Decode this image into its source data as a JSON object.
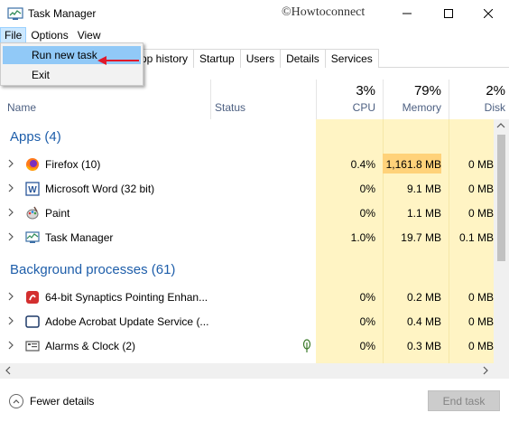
{
  "window": {
    "title": "Task Manager",
    "watermark": "©Howtoconnect",
    "minimize_glyph": "—",
    "maximize_glyph": "☐",
    "close_glyph": "✕"
  },
  "menu": {
    "file": "File",
    "options": "Options",
    "view": "View"
  },
  "file_menu": {
    "run_new_task": "Run new task",
    "exit": "Exit"
  },
  "tabs": [
    "pp history",
    "Startup",
    "Users",
    "Details",
    "Services"
  ],
  "columns": {
    "name": "Name",
    "status": "Status",
    "cpu_pct": "3%",
    "cpu": "CPU",
    "memory_pct": "79%",
    "memory": "Memory",
    "disk_pct": "2%",
    "disk": "Disk"
  },
  "groups": {
    "apps": "Apps (4)",
    "background": "Background processes (61)"
  },
  "apps": [
    {
      "name": "Firefox (10)",
      "icon": "firefox-icon",
      "cpu": "0.4%",
      "memory": "1,161.8 MB",
      "disk": "0 MB"
    },
    {
      "name": "Microsoft Word (32 bit)",
      "icon": "word-icon",
      "cpu": "0%",
      "memory": "9.1 MB",
      "disk": "0 MB"
    },
    {
      "name": "Paint",
      "icon": "paint-icon",
      "cpu": "0%",
      "memory": "1.1 MB",
      "disk": "0 MB"
    },
    {
      "name": "Task Manager",
      "icon": "task-manager-icon",
      "cpu": "1.0%",
      "memory": "19.7 MB",
      "disk": "0.1 MB"
    }
  ],
  "background": [
    {
      "name": "64-bit Synaptics Pointing Enhan...",
      "icon": "synaptics-icon",
      "cpu": "0%",
      "memory": "0.2 MB",
      "disk": "0 MB"
    },
    {
      "name": "Adobe Acrobat Update Service (...",
      "icon": "service-icon",
      "cpu": "0%",
      "memory": "0.4 MB",
      "disk": "0 MB"
    },
    {
      "name": "Alarms & Clock (2)",
      "icon": "alarms-icon",
      "cpu": "0%",
      "memory": "0.3 MB",
      "disk": "0 MB",
      "status_icon": "leaf-icon"
    }
  ],
  "footer": {
    "fewer_details": "Fewer details",
    "end_task": "End task"
  },
  "colors": {
    "accent": "#1e5eaa",
    "highlight": "#91c9f7",
    "heat_light": "#fff4c4",
    "heat_strong": "#ffd27a",
    "arrow": "#e0192b"
  }
}
